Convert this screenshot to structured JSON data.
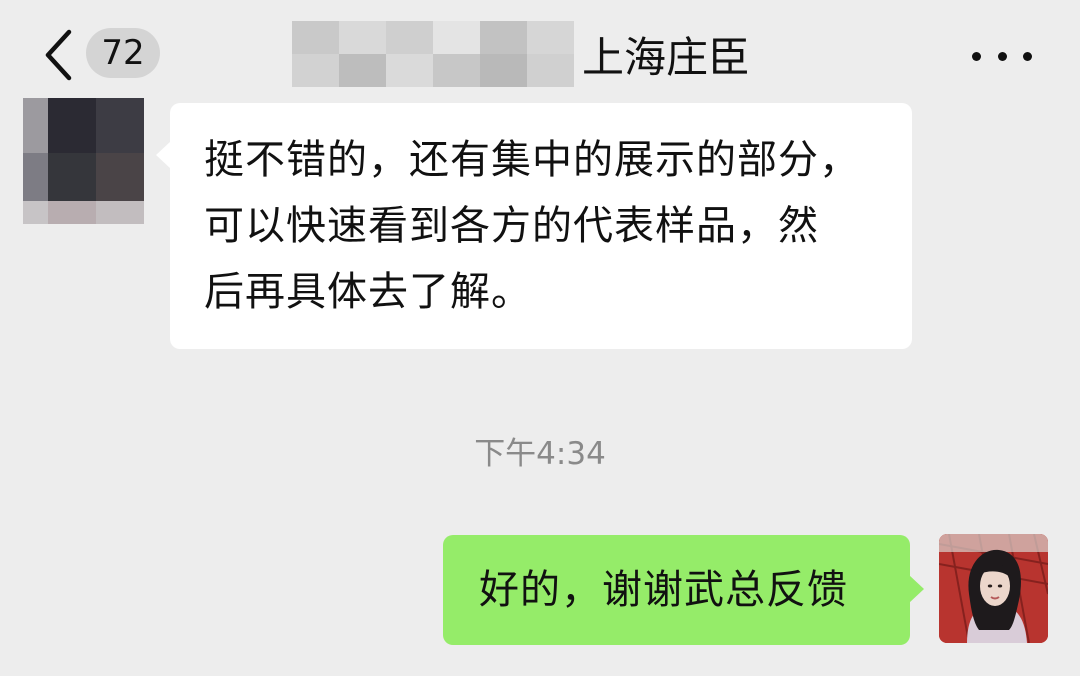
{
  "header": {
    "unread_count": "72",
    "title": "上海庄臣"
  },
  "messages": {
    "incoming": {
      "lines": [
        "挺不错的，还有集中的展示的部分，",
        "可以快速看到各方的代表样品，然",
        "后再具体去了解。"
      ]
    },
    "timestamp": "下午4:34",
    "outgoing": {
      "text": "好的，谢谢武总反馈"
    }
  },
  "icons": {
    "back": "chevron-left-icon",
    "more": "more-dots-icon"
  },
  "colors": {
    "background": "#ededed",
    "incoming_bubble": "#ffffff",
    "outgoing_bubble": "#95ec69",
    "timestamp": "#8a8a8a"
  }
}
